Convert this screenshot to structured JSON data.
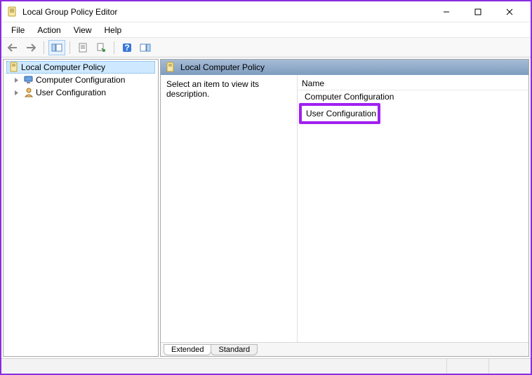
{
  "window": {
    "title": "Local Group Policy Editor"
  },
  "menu": {
    "file": "File",
    "action": "Action",
    "view": "View",
    "help": "Help"
  },
  "toolbar": {
    "back": "back-arrow",
    "forward": "forward-arrow",
    "show_hide_tree": "show-hide-console-tree",
    "properties": "properties",
    "export": "export-list",
    "help": "help",
    "show_hide_action": "show-hide-action-pane"
  },
  "tree": {
    "root": {
      "label": "Local Computer Policy"
    },
    "children": [
      {
        "label": "Computer Configuration",
        "icon": "computer"
      },
      {
        "label": "User Configuration",
        "icon": "user"
      }
    ]
  },
  "details": {
    "header": "Local Computer Policy",
    "description_prompt": "Select an item to view its description.",
    "columns": {
      "name": "Name"
    },
    "items": [
      {
        "label": "Computer Configuration",
        "icon": "computer",
        "highlight": false
      },
      {
        "label": "User Configuration",
        "icon": "user",
        "highlight": true
      }
    ],
    "tabs": {
      "extended": "Extended",
      "standard": "Standard",
      "active": "extended"
    }
  },
  "colors": {
    "highlight": "#a020f0",
    "window_border": "#8a2be2",
    "header_grad_top": "#a7bcd6",
    "header_grad_bottom": "#7e9cc0",
    "tree_selection": "#cde8ff"
  }
}
